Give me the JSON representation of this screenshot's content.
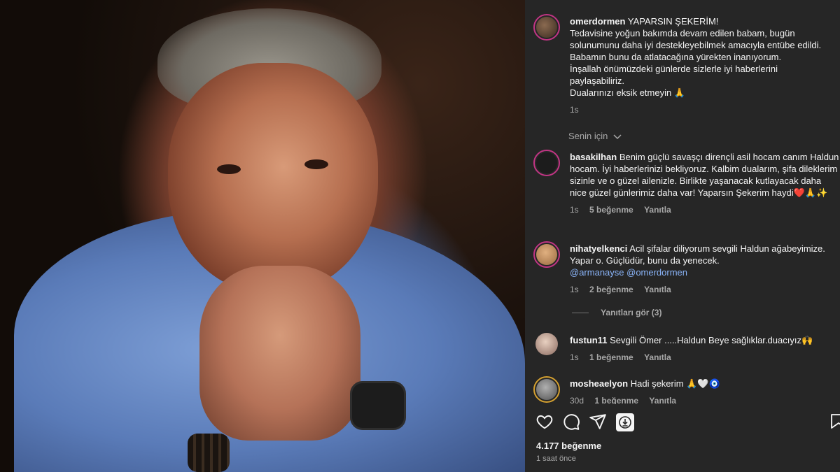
{
  "post": {
    "caption": {
      "username": "omerdormen",
      "title": "YAPARSIN ŞEKERİM!",
      "lines": [
        "Tedavisine yoğun bakımda devam edilen babam, bugün",
        "solunumunu daha iyi destekleyebilmek amacıyla entübe edildi.",
        "Babamın bunu da atlatacağına yürekten inanıyorum.",
        "İnşallah önümüzdeki günlerde sizlerle iyi haberlerini",
        "paylaşabiliriz.",
        "Dualarınızı eksik etmeyin 🙏"
      ],
      "time": "1s"
    },
    "translate_label": "Senin için",
    "likes": "4.177 beğenme",
    "posted_time": "1 saat önce"
  },
  "comments": [
    {
      "username": "basakilhan",
      "text": "Benim güçlü savaşçı dirençli asil hocam canım Haldun hocam. İyi haberlerinizi bekliyoruz. Kalbim dualarım, şifa dileklerim sizinle ve o güzel ailenizle. Birlikte yaşanacak kutlayacak daha nice güzel günlerimiz daha var! Yaparsın Şekerim haydi❤️🙏✨",
      "time": "1s",
      "likes": "5 beğenme",
      "reply": "Yanıtla"
    },
    {
      "username": "nihatyelkenci",
      "text": "Acil şifalar diliyorum sevgili Haldun ağabeyimize. Yapar o. Güçlüdür, bunu da yenecek.",
      "mentions": "@armanayse @omerdormen",
      "time": "1s",
      "likes": "2 beğenme",
      "reply": "Yanıtla"
    },
    {
      "username": "fustun11",
      "text": "Sevgili Ömer .....Haldun Beye sağlıklar.duacıyız🙌",
      "time": "1s",
      "likes": "1 beğenme",
      "reply": "Yanıtla"
    },
    {
      "username": "mosheaelyon",
      "text": "Hadi şekerim 🙏🤍🧿",
      "time": "30d",
      "likes": "1 beğenme",
      "reply": "Yanıtla"
    }
  ],
  "view_replies": "Yanıtları gör (3)",
  "colors": {
    "panel_bg": "#262626",
    "mention": "#8ab4f8",
    "ring": "#c13584"
  },
  "icons": [
    "heart-icon",
    "comment-icon",
    "share-icon",
    "save-post-icon",
    "bookmark-icon"
  ]
}
